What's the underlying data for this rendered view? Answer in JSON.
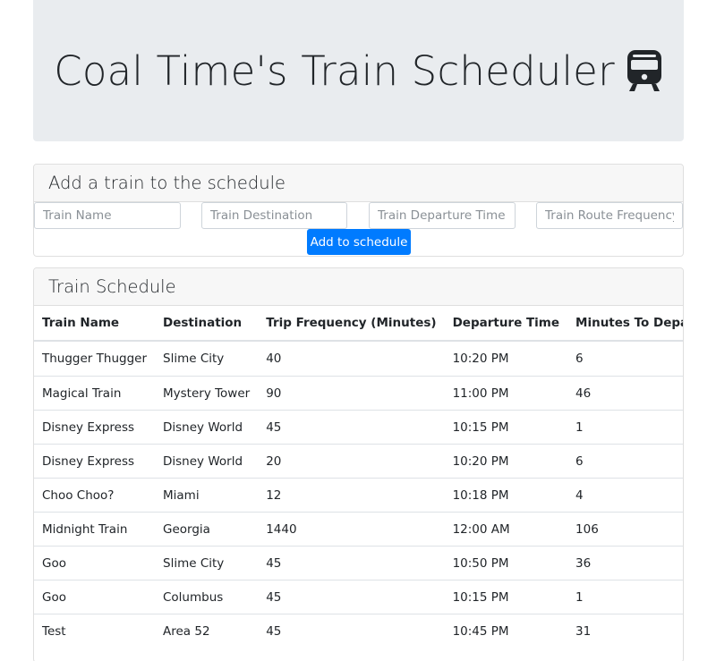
{
  "header": {
    "title": "Coal Time's Train Scheduler",
    "icon": "train-icon"
  },
  "add_form": {
    "heading": "Add a train to the schedule",
    "fields": {
      "name_placeholder": "Train Name",
      "destination_placeholder": "Train Destination",
      "departure_placeholder": "Train Departure Time (MM:HH)",
      "frequency_placeholder": "Train Route Frequency (Minutes)"
    },
    "submit_label": "Add to schedule"
  },
  "schedule": {
    "heading": "Train Schedule",
    "columns": [
      "Train Name",
      "Destination",
      "Trip Frequency (Minutes)",
      "Departure Time",
      "Minutes To Departure"
    ],
    "rows": [
      [
        "Thugger Thugger",
        "Slime City",
        "40",
        "10:20 PM",
        "6"
      ],
      [
        "Magical Train",
        "Mystery Tower",
        "90",
        "11:00 PM",
        "46"
      ],
      [
        "Disney Express",
        "Disney World",
        "45",
        "10:15 PM",
        "1"
      ],
      [
        "Disney Express",
        "Disney World",
        "20",
        "10:20 PM",
        "6"
      ],
      [
        "Choo Choo?",
        "Miami",
        "12",
        "10:18 PM",
        "4"
      ],
      [
        "Midnight Train",
        "Georgia",
        "1440",
        "12:00 AM",
        "106"
      ],
      [
        "Goo",
        "Slime City",
        "45",
        "10:50 PM",
        "36"
      ],
      [
        "Goo",
        "Columbus",
        "45",
        "10:15 PM",
        "1"
      ],
      [
        "Test",
        "Area 52",
        "45",
        "10:45 PM",
        "31"
      ]
    ]
  },
  "colors": {
    "jumbotron_bg": "#e9ecef",
    "primary": "#007bff",
    "card_header_bg": "#f7f7f7"
  }
}
